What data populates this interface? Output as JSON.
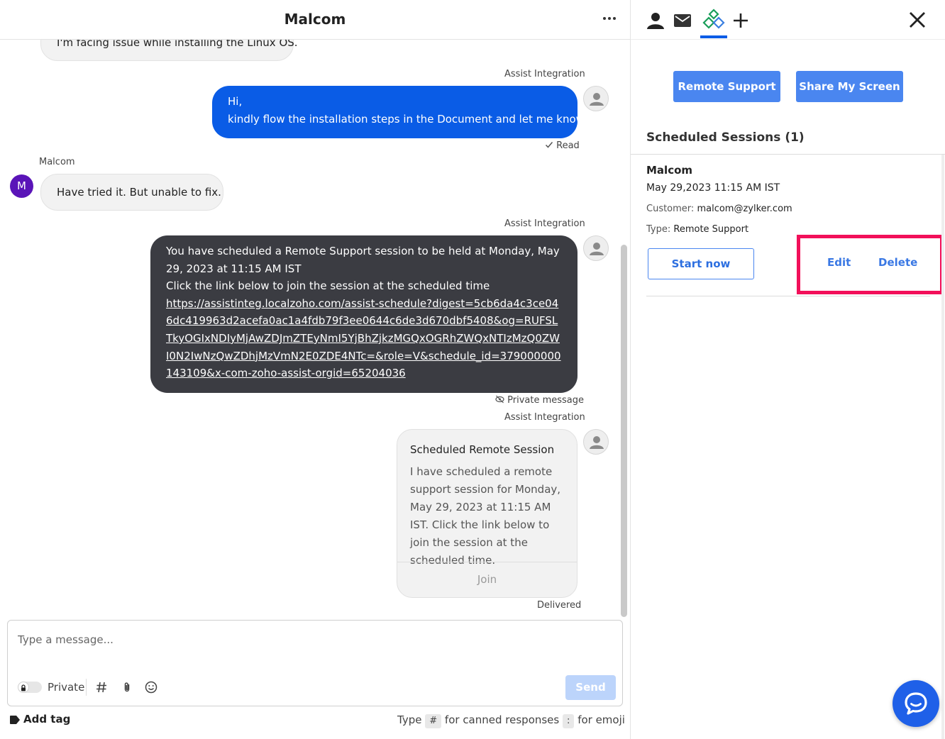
{
  "chat": {
    "title": "Malcom",
    "first_message": "I'm facing issue while installing the Linux OS.",
    "msg2": {
      "sender": "Assist Integration",
      "line1": "Hi,",
      "line2": "kindly flow the installation steps in the Document and let me know.",
      "status": "Read"
    },
    "msg3": {
      "sender": "Malcom",
      "avatar_letter": "M",
      "text": "Have tried it. But unable to fix."
    },
    "msg4": {
      "sender": "Assist Integration",
      "line1": "You have scheduled a Remote Support session to be held at Monday, May 29, 2023 at 11:15 AM IST",
      "line2": "Click the link below to join the session at the scheduled time",
      "link": "https://assistinteg.localzoho.com/assist-schedule?digest=5cb6da4c3ce046dc419963d2acefa0ac1a4fdb79f3ee0644c6de3d670dbf5408&og=RUFSLTkyOGIxNDIyMjAwZDJmZTEyNmI5YjBhZjkzMGQxOGRhZWQxNTIzMzQ0ZWI0N2IwNzQwZDhjMzVmN2E0ZDE4NTc=&role=V&schedule_id=379000000143109&x-com-zoho-assist-orgid=65204036",
      "status": "Private message"
    },
    "msg5": {
      "sender": "Assist Integration",
      "card_title": "Scheduled Remote Session",
      "card_body": "I have scheduled a remote support session for Monday, May 29, 2023 at 11:15 AM IST. Click the link below to join the session at the scheduled time.",
      "join_label": "Join",
      "status": "Delivered"
    }
  },
  "composer": {
    "placeholder": "Type a message...",
    "private_label": "Private",
    "send_label": "Send",
    "add_tag_label": "Add tag",
    "hint_type": "Type",
    "hint_hash": "#",
    "hint_canned": "for canned responses",
    "hint_colon": ":",
    "hint_emoji": "for emoji"
  },
  "panel": {
    "remote_support_label": "Remote Support",
    "share_screen_label": "Share My Screen",
    "section_title": "Scheduled Sessions (1)",
    "session": {
      "name": "Malcom",
      "datetime": "May 29,2023 11:15 AM IST",
      "customer_label": "Customer:",
      "customer_value": "malcom@zylker.com",
      "type_label": "Type:",
      "type_value": "Remote Support",
      "start_label": "Start now",
      "edit_label": "Edit",
      "delete_label": "Delete"
    }
  },
  "colors": {
    "accent": "#0a5ce6",
    "dark_bubble": "#3b3c42",
    "highlight": "#f2105a",
    "brand_green": "#1a9e5a"
  },
  "icons": [
    "user-icon",
    "mail-icon",
    "zoho-assist-icon",
    "plus-icon",
    "close-icon",
    "more-icon",
    "lock-icon",
    "hash-icon",
    "attachment-icon",
    "emoji-icon",
    "tag-icon",
    "eye-off-icon",
    "check-icon",
    "chat-bubble-icon"
  ]
}
